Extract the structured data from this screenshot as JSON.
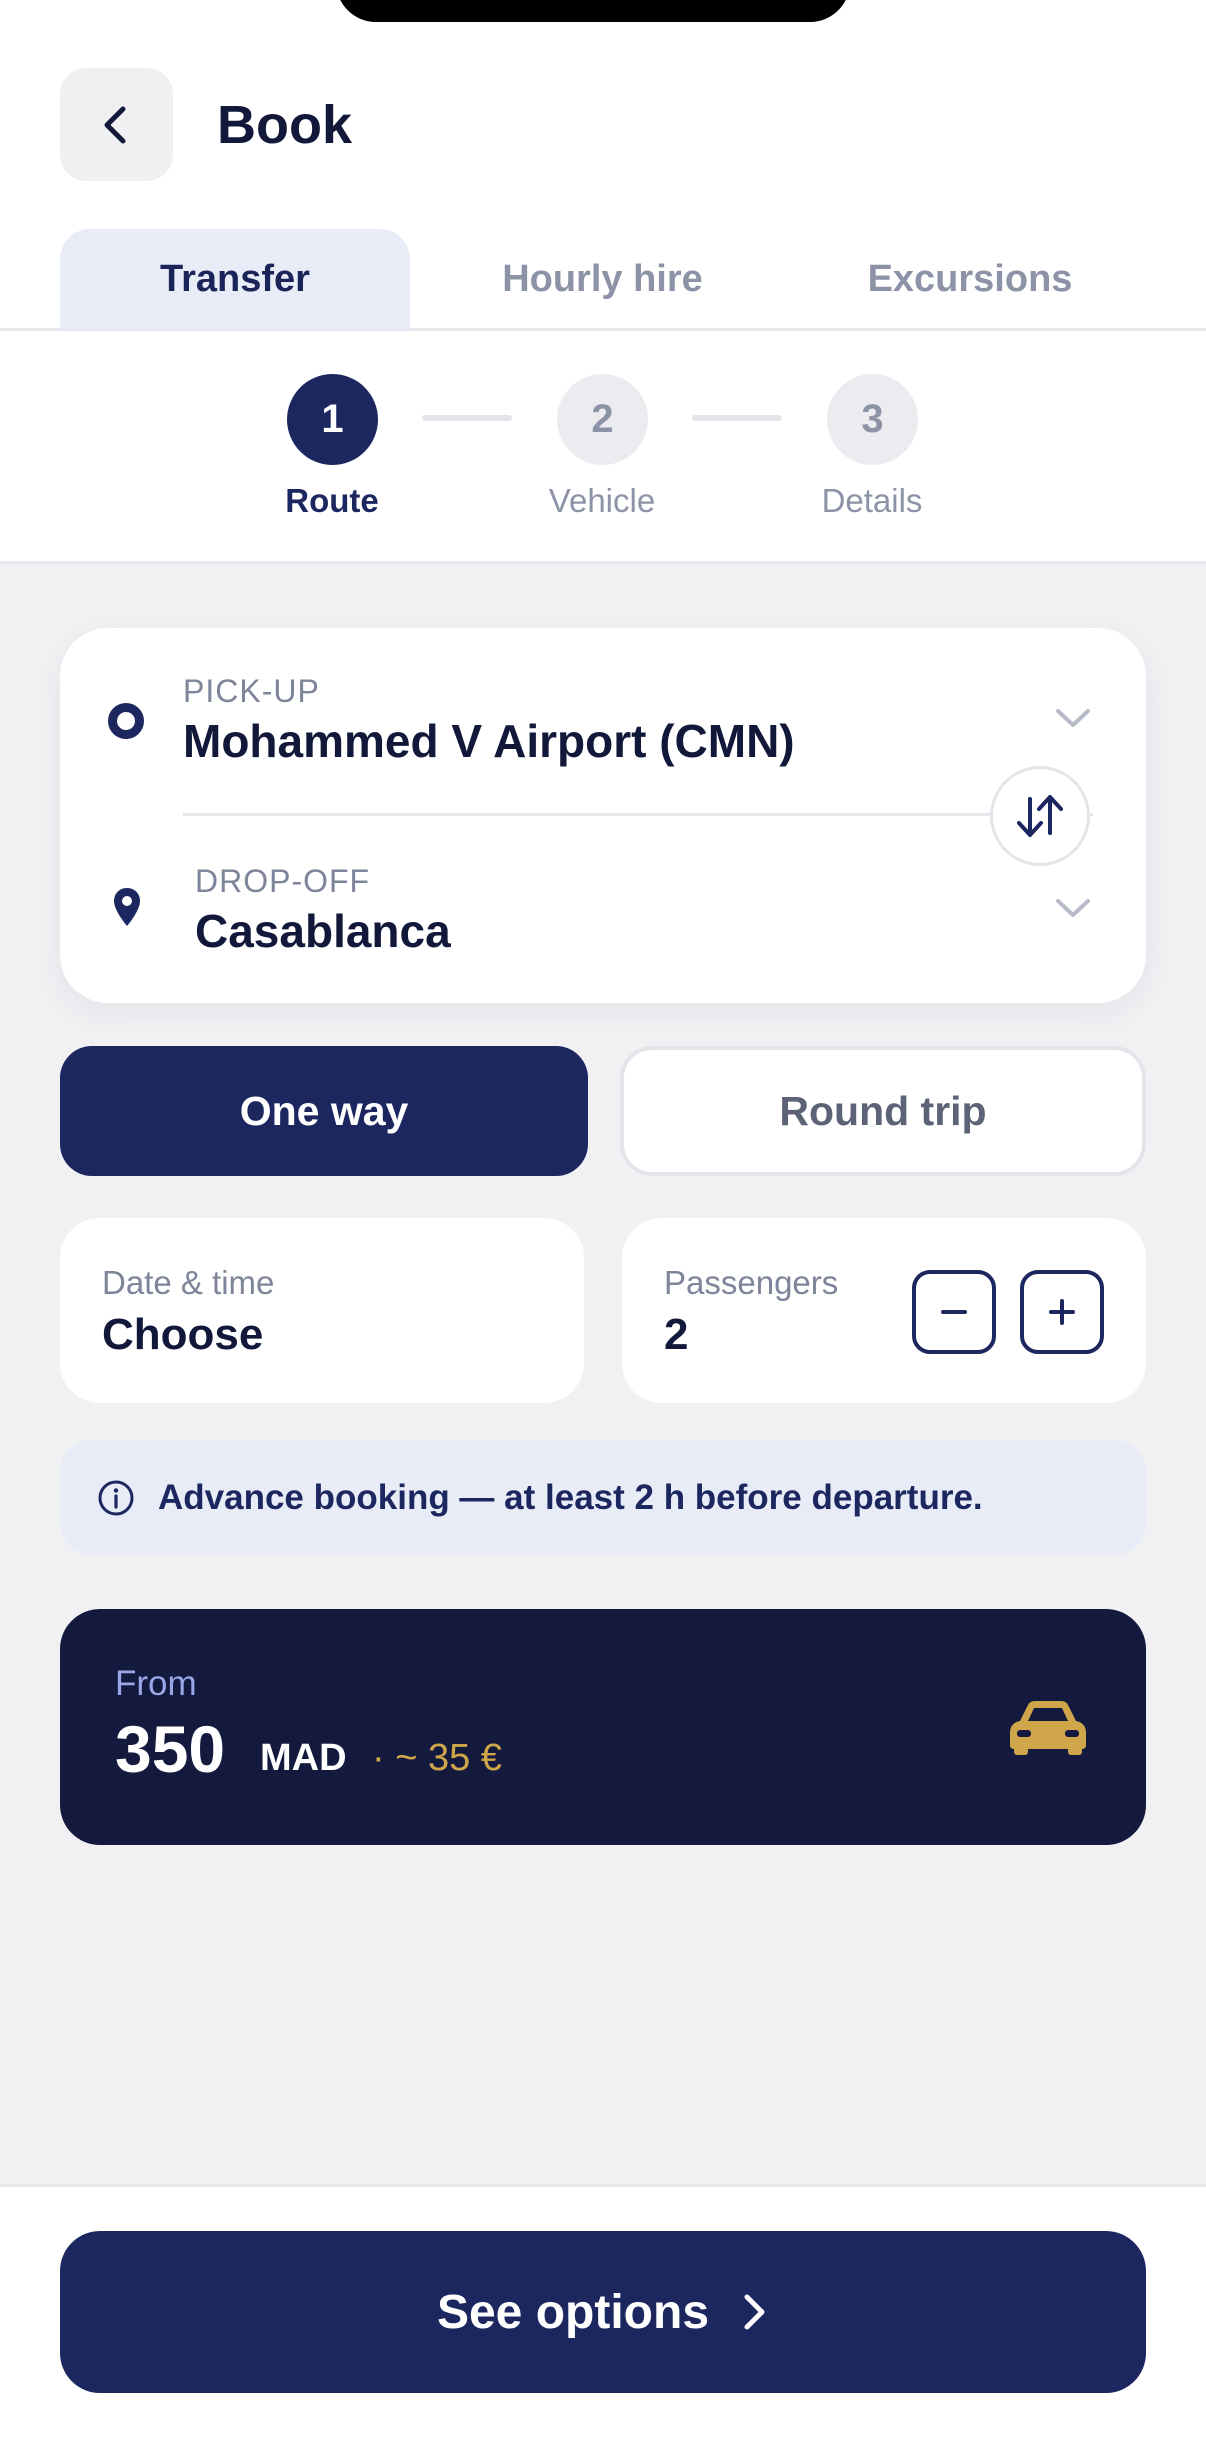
{
  "header": {
    "title": "Book"
  },
  "tabs": [
    {
      "label": "Transfer",
      "active": true
    },
    {
      "label": "Hourly hire",
      "active": false
    },
    {
      "label": "Excursions",
      "active": false
    }
  ],
  "stepper": {
    "steps": [
      {
        "number": "1",
        "label": "Route",
        "active": true
      },
      {
        "number": "2",
        "label": "Vehicle",
        "active": false
      },
      {
        "number": "3",
        "label": "Details",
        "active": false
      }
    ]
  },
  "route": {
    "pickup_label": "PICK-UP",
    "pickup_value": "Mohammed V Airport (CMN)",
    "dropoff_label": "DROP-OFF",
    "dropoff_value": "Casablanca"
  },
  "trip_type": {
    "one_way": "One way",
    "round_trip": "Round trip",
    "selected": "One way"
  },
  "date_time": {
    "label": "Date & time",
    "value": "Choose"
  },
  "passengers": {
    "label": "Passengers",
    "value": "2"
  },
  "info": {
    "text": "Advance booking — at least 2 h before departure."
  },
  "price": {
    "from_label": "From",
    "amount": "350",
    "currency": "MAD",
    "euro_equivalent": "· ~ 35 €"
  },
  "cta": {
    "label": "See options"
  },
  "colors": {
    "primary": "#1c2760",
    "dark_card": "#141a3d",
    "accent_gold": "#d0a64a",
    "tab_active_bg": "#e8ecf7"
  },
  "icons": {
    "back": "chevron-left-icon",
    "pickup": "circle-outline-icon",
    "dropoff": "map-pin-icon",
    "swap": "swap-vertical-icon",
    "info": "info-circle-icon",
    "car": "car-icon",
    "cta": "chevron-right-icon"
  }
}
